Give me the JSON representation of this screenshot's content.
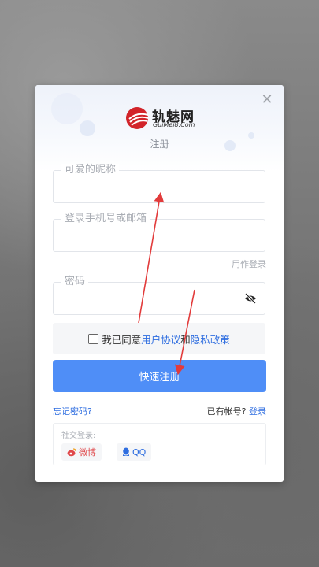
{
  "modal": {
    "close_icon": "close-icon",
    "logo": {
      "name": "轨魅网",
      "sub": "GuiMei8.Com"
    },
    "subtitle": "注册",
    "fields": {
      "nickname": {
        "placeholder": "可爱的昵称",
        "value": ""
      },
      "account": {
        "placeholder": "登录手机号或邮箱",
        "value": "",
        "hint": "用作登录"
      },
      "password": {
        "placeholder": "密码",
        "value": "",
        "toggle_icon": "eye-slash-icon"
      }
    },
    "agreement": {
      "prefix": "我已同意",
      "terms": "用户协议",
      "and": "和",
      "privacy": "隐私政策",
      "checked": false
    },
    "submit_label": "快速注册",
    "forgot_label": "忘记密码?",
    "have_account": {
      "text": "已有帐号?",
      "login": "登录"
    },
    "social": {
      "label": "社交登录:",
      "weibo": {
        "label": "微博",
        "icon": "weibo-icon"
      },
      "qq": {
        "label": "QQ",
        "icon": "qq-icon"
      }
    }
  },
  "colors": {
    "accent": "#4f8ef7",
    "link": "#2f6ee0",
    "logo_red": "#d2242a",
    "annotation_arrow": "#e23b3b"
  }
}
